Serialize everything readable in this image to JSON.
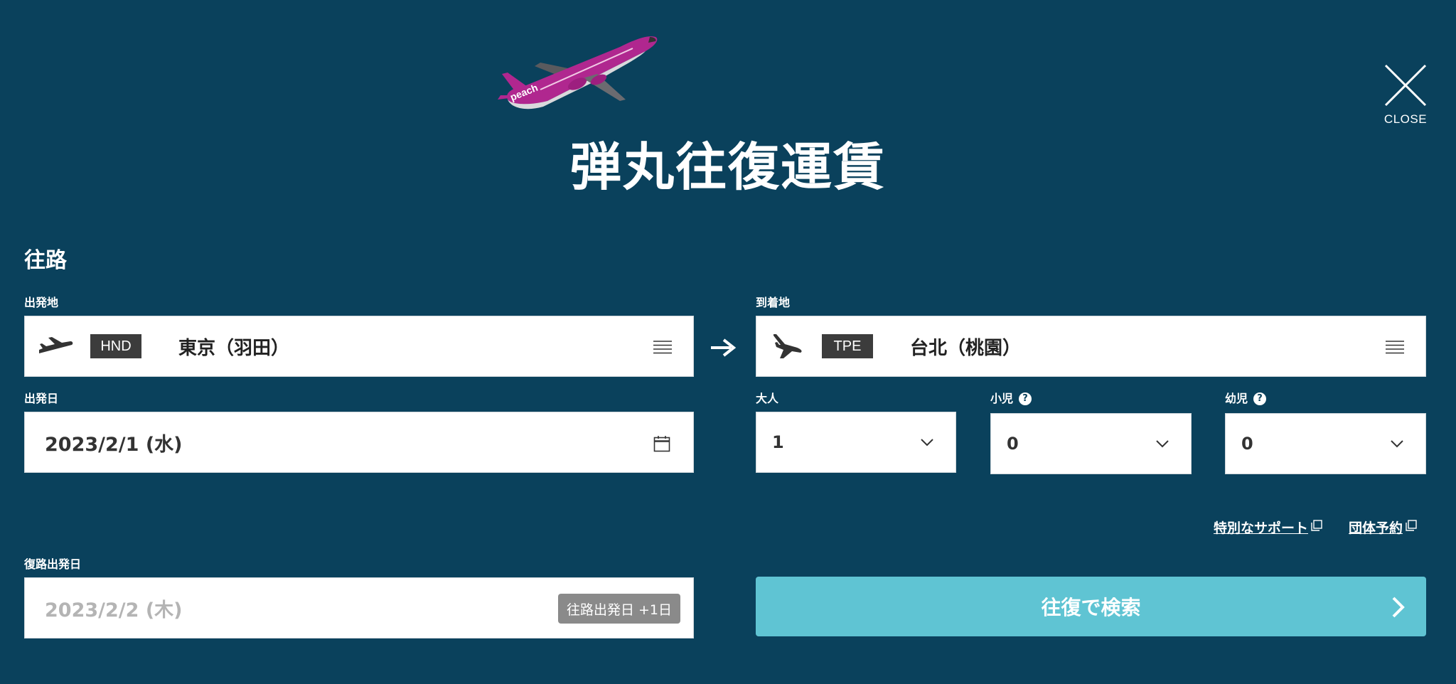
{
  "header": {
    "title": "弾丸往復運賃",
    "close_label": "CLOSE"
  },
  "outbound": {
    "heading": "往路",
    "departure": {
      "label": "出発地",
      "code": "HND",
      "name": "東京（羽田）"
    },
    "arrival": {
      "label": "到着地",
      "code": "TPE",
      "name": "台北（桃園）"
    },
    "date": {
      "label": "出発日",
      "value": "2023/2/1 (水)"
    }
  },
  "passengers": {
    "adult": {
      "label": "大人",
      "value": "1"
    },
    "child": {
      "label": "小児",
      "value": "0"
    },
    "infant": {
      "label": "幼児",
      "value": "0"
    }
  },
  "links": {
    "special_support": "特別なサポート",
    "group_booking": "団体予約"
  },
  "return": {
    "label": "復路出発日",
    "value": "2023/2/2 (木)",
    "offset_badge": "往路出発日 +1日"
  },
  "search_button": {
    "label": "往復で検索"
  },
  "colors": {
    "background": "#0a415c",
    "accent": "#5fc4d3",
    "plane_livery": "#b0278f",
    "badge": "#3c3c3c"
  }
}
